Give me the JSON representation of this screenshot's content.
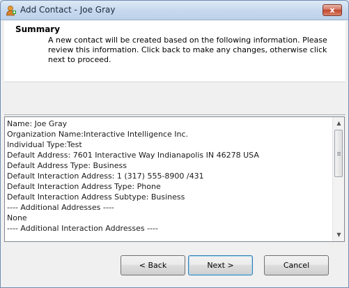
{
  "window": {
    "title": "Add Contact - Joe Gray",
    "close_label": "x",
    "icon": "contact-add-icon"
  },
  "summary": {
    "title": "Summary",
    "description": "A new contact will be created based on the following information.  Please review this information.  Click back to make any changes, otherwise click next to proceed."
  },
  "details": {
    "lines": [
      "Name: Joe Gray",
      "Organization Name:Interactive Intelligence Inc.",
      "Individual Type:Test",
      "Default Address:  7601 Interactive Way Indianapolis IN 46278 USA",
      "Default Address Type:  Business",
      "Default Interaction Address:  1 (317) 555-8900 /431",
      "Default Interaction Address Type:  Phone",
      "Default Interaction Address Subtype:  Business",
      "---- Additional Addresses ----",
      "None",
      "---- Additional Interaction Addresses ----"
    ],
    "scroll_up": "▲",
    "scroll_down": "▼"
  },
  "buttons": {
    "back": "< Back",
    "next": "Next >",
    "cancel": "Cancel"
  }
}
